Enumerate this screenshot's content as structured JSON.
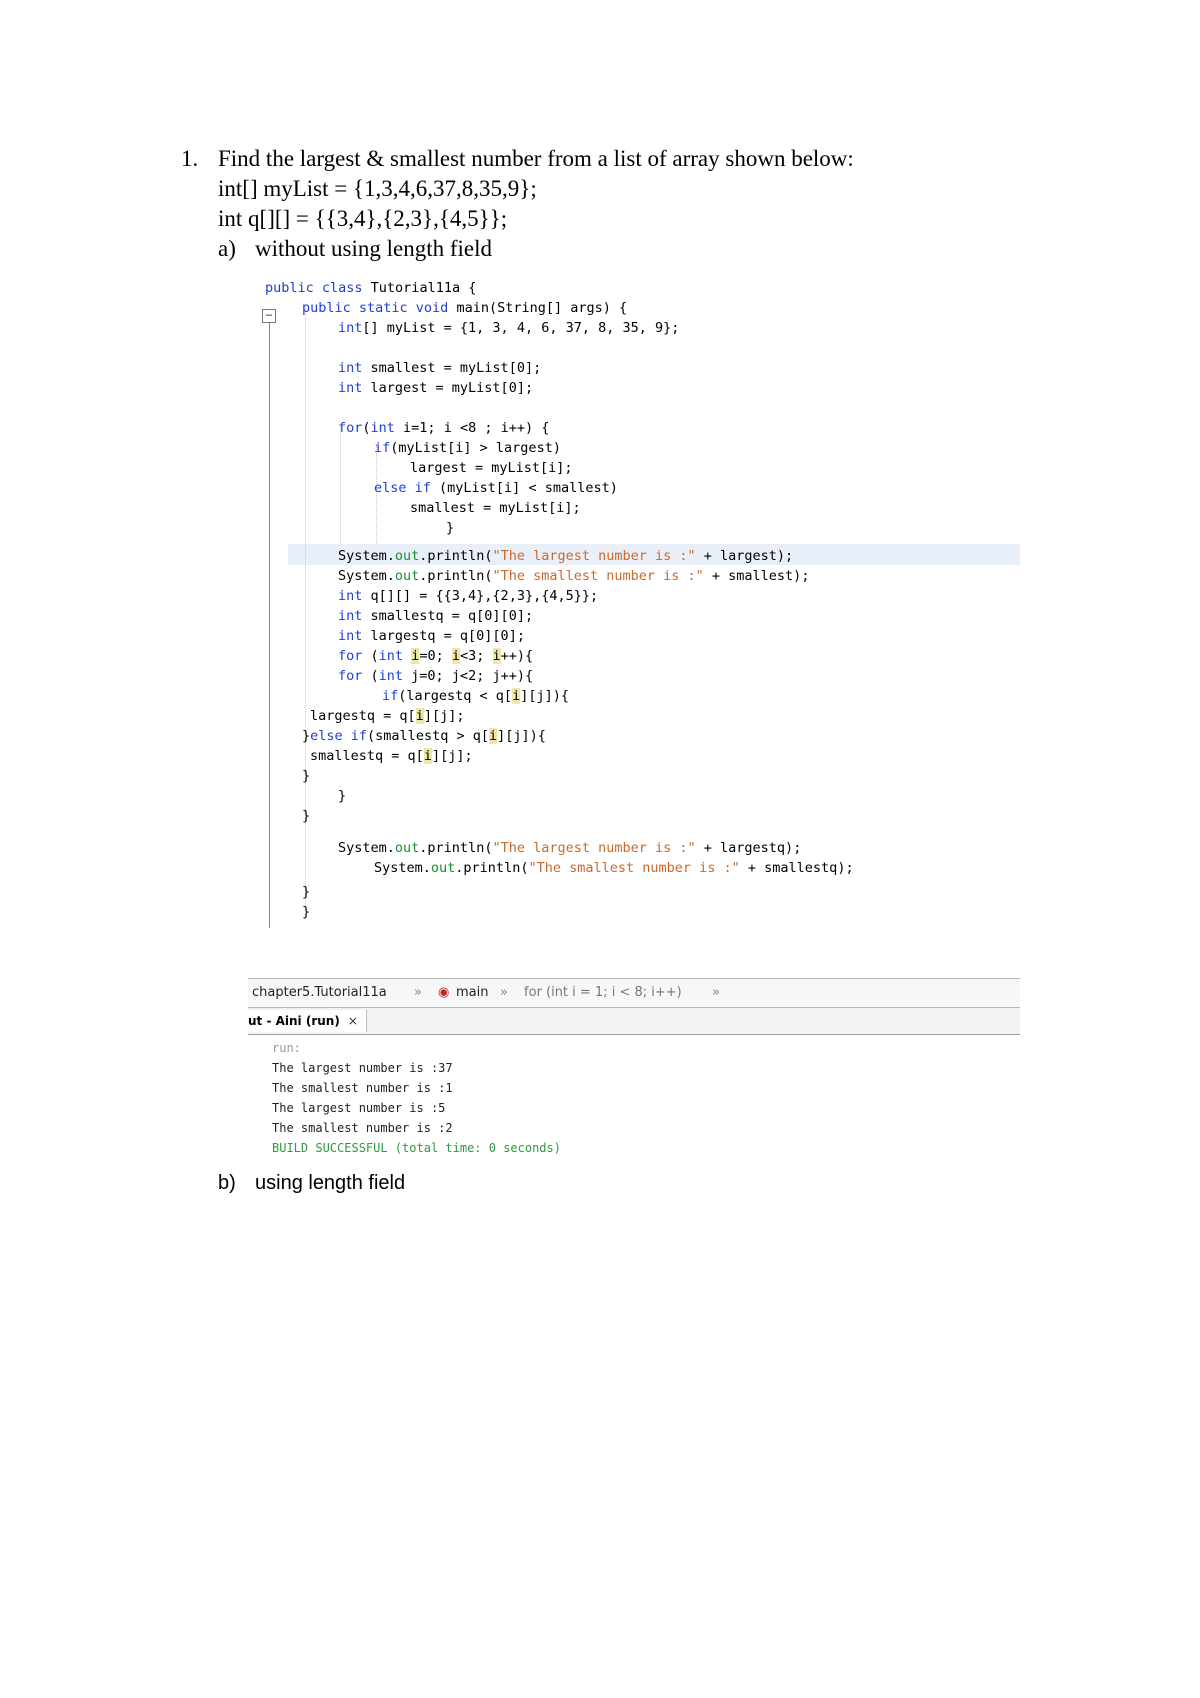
{
  "question": {
    "number": "1.",
    "lines": [
      "Find the largest & smallest number from a list of array shown below:",
      "int[] myList = {1,3,4,6,37,8,35,9};",
      "int q[][] = {{3,4},{2,3},{4,5}};"
    ],
    "part_a": {
      "label": "a)",
      "text": "without using length field"
    },
    "part_b": {
      "label": "b)",
      "text": "using length field"
    }
  },
  "code": {
    "l1": [
      "public class ",
      "Tutorial11a",
      " {"
    ],
    "l2": [
      "public static void ",
      "main(String[] args) {"
    ],
    "l3": [
      "int",
      "[] myList = {1, 3, 4, 6, 37, 8, 35, 9};"
    ],
    "l4": [
      "int",
      " smallest = myList[0];"
    ],
    "l5": [
      "int",
      " largest = myList[0];"
    ],
    "l6": [
      "for",
      "(",
      "int",
      " i=1; i <8 ; i++) {"
    ],
    "l7": [
      "if",
      "(myList[i] > largest)"
    ],
    "l8": "largest = myList[i];",
    "l9": [
      "else if",
      " (myList[i] < smallest)"
    ],
    "l10": "smallest = myList[i];",
    "l11": "}",
    "l12": [
      "System.",
      "out",
      ".println(",
      "\"The largest number is :\"",
      " + largest);"
    ],
    "l13": [
      "System.",
      "out",
      ".println(",
      "\"The smallest number is :\"",
      " + smallest);"
    ],
    "l14": [
      "int",
      " q[][] = {{3,4},{2,3},{4,5}};"
    ],
    "l15": [
      "int",
      " smallestq = q[0][0];"
    ],
    "l16": [
      "int",
      " largestq = q[0][0];"
    ],
    "l17": [
      "for",
      " (",
      "int",
      " ",
      "i",
      "=0; ",
      "i",
      "<3; ",
      "i",
      "++){"
    ],
    "l18": [
      "for",
      " (",
      "int",
      " j=0; j<2; j++){"
    ],
    "l19": [
      "if",
      "(largestq < q[",
      "i",
      "][j]){"
    ],
    "l20": [
      "largestq = q[",
      "i",
      "][j];"
    ],
    "l21": [
      "}",
      "else if",
      "(smallestq > q[",
      "i",
      "][j]){"
    ],
    "l22": [
      "smallestq = q[",
      "i",
      "][j];"
    ],
    "l23": "}",
    "l24": "}",
    "l25": "}",
    "l26": [
      "System.",
      "out",
      ".println(",
      "\"The largest number is :\"",
      " + largestq);"
    ],
    "l27": [
      "System.",
      "out",
      ".println(",
      "\"The smallest number is :\"",
      " + smallestq);"
    ],
    "l28": "}",
    "l29": "}"
  },
  "breadcrumb": {
    "class": "chapter5.Tutorial11a",
    "method": "main",
    "loop": "for (int i = 1; i < 8; i++)"
  },
  "output_tab": {
    "label": "ut - Aini (run)",
    "close": "×"
  },
  "output": [
    "run:",
    "The largest number is :37",
    "The smallest number is :1",
    "The largest number is :5",
    "The smallest number is :2",
    "BUILD SUCCESSFUL (total time: 0 seconds)"
  ]
}
